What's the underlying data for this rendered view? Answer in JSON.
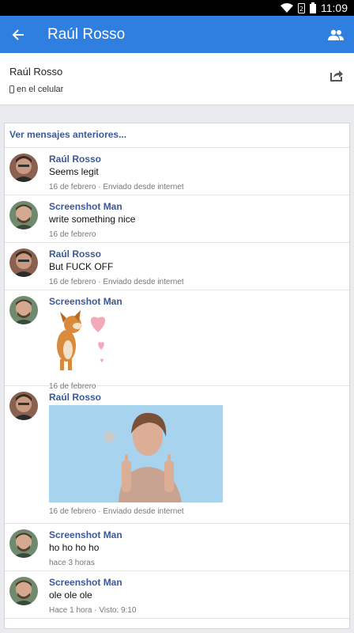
{
  "status_bar": {
    "time": "11:09"
  },
  "app_bar": {
    "title": "Raúl Rosso",
    "back_icon": "arrow-left-icon",
    "action_icon": "people-icon"
  },
  "profile": {
    "name": "Raúl Rosso",
    "status": "en el celular",
    "share_icon": "share-icon"
  },
  "thread": {
    "older_label": "Ver mensajes anteriores...",
    "messages": [
      {
        "sender": "Raúl Rosso",
        "text": "Seems legit",
        "meta": "16 de febrero · Enviado desde internet"
      },
      {
        "sender": "Screenshot Man",
        "text": "write something nice",
        "meta": "16 de febrero"
      },
      {
        "sender": "Raúl Rosso",
        "text": "But FUCK OFF",
        "meta": "16 de febrero · Enviado desde internet"
      },
      {
        "sender": "Screenshot Man",
        "text": "",
        "meta": "16 de febrero"
      },
      {
        "sender": "Raúl Rosso",
        "text": "",
        "meta": "16 de febrero · Enviado desde internet"
      },
      {
        "sender": "Screenshot Man",
        "text": "ho ho ho ho",
        "meta": "hace 3 horas"
      },
      {
        "sender": "Screenshot Man",
        "text": "ole ole ole",
        "meta": "Hace 1 hora · Visto: 9:10"
      }
    ]
  },
  "colors": {
    "app_bar": "#2f7fe0",
    "link": "#3b5998"
  }
}
